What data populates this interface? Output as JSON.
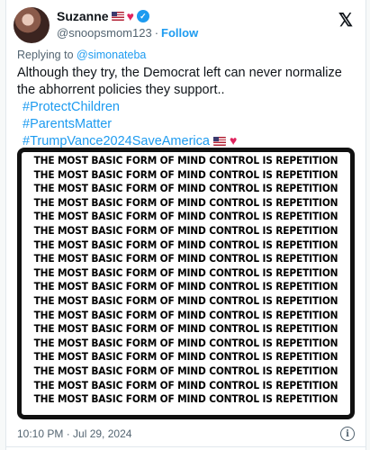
{
  "user": {
    "name": "Suzanne",
    "handle": "@snoopsmom123",
    "follow_label": "Follow",
    "separator": "·"
  },
  "reply": {
    "prefix": "Replying to",
    "mention": "@simonateba"
  },
  "tweet": {
    "line1": "Although they try, the Democrat left can never normalize",
    "line2": "the abhorrent policies they  support..",
    "hashtags": [
      "#ProtectChildren",
      "#ParentsMatter",
      "#TrumpVance2024SaveAmerica"
    ]
  },
  "media": {
    "repeated_text": "THE MOST BASIC FORM OF MIND CONTROL IS REPETITION",
    "line_count": 18
  },
  "meta": {
    "timestamp": "10:10 PM · Jul 29, 2024"
  },
  "colors": {
    "accent": "#1d9bf0",
    "heart": "#e0245e",
    "secondary_text": "#536471"
  },
  "icons": {
    "logo": "x-logo-icon",
    "verified": "verified-badge-icon",
    "info": "info-icon"
  }
}
